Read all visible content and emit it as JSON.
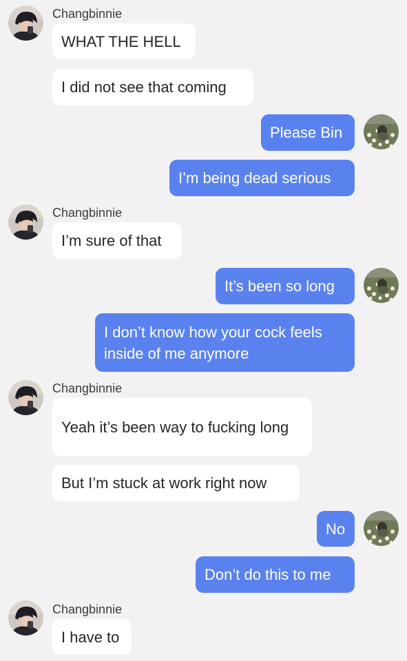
{
  "contact_name": "Changbinnie",
  "avatars": {
    "contact": "avatar-dark-haired-person",
    "self": "avatar-flower-field"
  },
  "colors": {
    "background": "#f2f2f2",
    "incoming_bubble": "#ffffff",
    "outgoing_bubble": "#5a82ef",
    "incoming_text": "#262626",
    "outgoing_text": "#ffffff"
  },
  "messages": [
    {
      "direction": "incoming",
      "text": "WHAT THE HELL"
    },
    {
      "direction": "incoming",
      "text": "I did not see that coming"
    },
    {
      "direction": "outgoing",
      "text": "Please Bin"
    },
    {
      "direction": "outgoing",
      "text": "I’m being dead serious"
    },
    {
      "direction": "incoming",
      "text": "I’m sure of that"
    },
    {
      "direction": "outgoing",
      "text": "It’s been so long"
    },
    {
      "direction": "outgoing",
      "text": "I don’t know how your cock feels inside of me anymore"
    },
    {
      "direction": "incoming",
      "text": "Yeah it’s been way to fucking long"
    },
    {
      "direction": "incoming",
      "text": "But I’m stuck at work right now"
    },
    {
      "direction": "outgoing",
      "text": "No"
    },
    {
      "direction": "outgoing",
      "text": "Don’t do this to me"
    },
    {
      "direction": "incoming",
      "text": "I have to"
    }
  ]
}
